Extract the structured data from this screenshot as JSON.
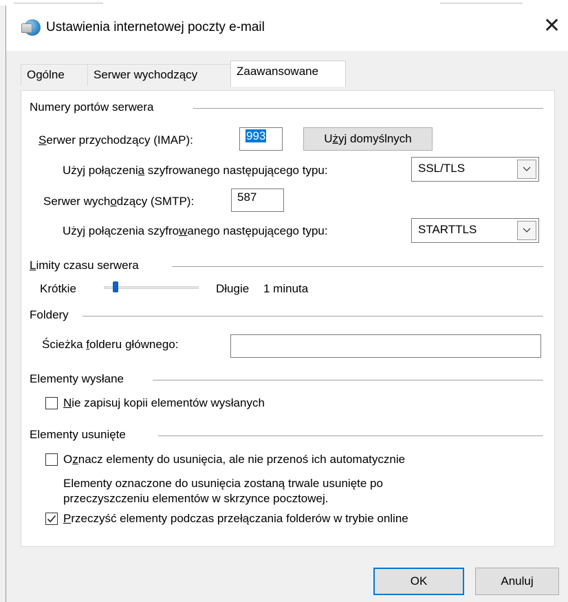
{
  "window": {
    "title": "Ustawienia internetowej poczty e-mail",
    "close_glyph": "✕",
    "app_icon": "outlook-globe-icon"
  },
  "tabs": [
    {
      "label": "Ogólne",
      "active": false
    },
    {
      "label": "Serwer wychodzący",
      "active": false
    },
    {
      "label": "Zaawansowane",
      "active": true
    }
  ],
  "ports": {
    "section_title": "Numery portów serwera",
    "incoming": {
      "label_first": "S",
      "label_rest": "erwer przychodzący (IMAP):",
      "value": "993",
      "default_button": {
        "pre": "U",
        "ul": "ż",
        "post": "yj domyślnych"
      }
    },
    "incoming_encryption": {
      "label_pre": "Użyj połączeni",
      "label_ul": "a",
      "label_post": " szyfrowanego następującego typu:",
      "value": "SSL/TLS"
    },
    "outgoing": {
      "label_pre": "Serwer wych",
      "label_ul": "o",
      "label_post": "dzący (SMTP):",
      "value": "587"
    },
    "outgoing_encryption": {
      "label_pre": "Użyj połączenia szyfro",
      "label_ul": "w",
      "label_post": "anego następującego typu:",
      "value": "STARTTLS"
    }
  },
  "timeouts": {
    "section_first": "L",
    "section_rest": "imity czasu serwera",
    "short_label": "Krótkie",
    "long_label": "Długie",
    "value_text": "1 minuta",
    "slider_level": 0.1
  },
  "folders": {
    "section_title": "Foldery",
    "root_label_pre": "Ścieżka ",
    "root_label_ul": "f",
    "root_label_post": "olderu głównego:",
    "root_value": ""
  },
  "sent": {
    "section_title": "Elementy wysłane",
    "checkbox": {
      "ul": "N",
      "rest": "ie zapisuj kopii elementów wysłanych",
      "checked": false
    }
  },
  "deleted": {
    "section_title": "Elementy usunięte",
    "mark_checkbox": {
      "pre": "O",
      "ul": "z",
      "post": "nacz elementy do usunięcia, ale nie przenoś ich automatycznie",
      "checked": false
    },
    "info_line1": "Elementy oznaczone do usunięcia zostaną trwale usunięte po",
    "info_line2": "przeczyszczeniu elementów w skrzynce pocztowej.",
    "purge_checkbox": {
      "ul": "P",
      "rest": "rzeczyść elementy podczas przełączania folderów w trybie online",
      "checked": true
    }
  },
  "buttons": {
    "ok": "OK",
    "cancel": "Anuluj"
  }
}
